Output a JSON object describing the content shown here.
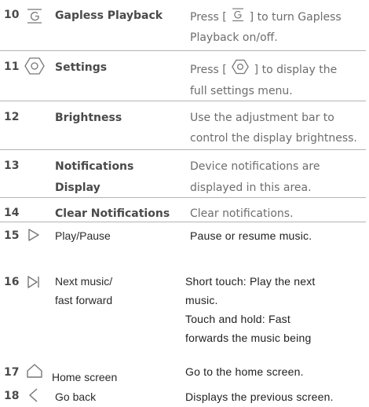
{
  "rows": [
    {
      "num": "10",
      "icon": "gapless-playback-icon",
      "name": "Gapless Playback",
      "desc_pre": "Press [",
      "desc_post": "] to turn Gapless",
      "desc_line2": "Playback on/off."
    },
    {
      "num": "11",
      "icon": "settings-icon",
      "name": "Settings",
      "desc_pre": "Press [",
      "desc_post": "] to display the",
      "desc_line2": "full settings menu."
    },
    {
      "num": "12",
      "name": "Brightness",
      "desc_line1": "Use the adjustment bar to",
      "desc_line2": "control the display brightness."
    },
    {
      "num": "13",
      "name_line1": "Notifications",
      "name_line2": "Display",
      "desc_line1": "Device notifications are",
      "desc_line2": "displayed in this area."
    },
    {
      "num": "14",
      "name": "Clear Notifications",
      "desc_line1": "Clear notifications."
    },
    {
      "num": "15",
      "icon": "play-pause-icon",
      "name": "Play/Pause",
      "desc_line1": "Pause or resume music."
    },
    {
      "num": "16",
      "icon": "next-icon",
      "name_line1": "Next music/",
      "name_line2": "fast forward",
      "desc_line1": "Short touch: Play the next",
      "desc_line2": "music.",
      "desc_line3": "Touch and hold: Fast",
      "desc_line4": "forwards the music being"
    },
    {
      "num": "17",
      "icon": "home-icon",
      "name": "Home screen",
      "desc_line1": "Go to the home screen."
    },
    {
      "num": "18",
      "icon": "back-icon",
      "name": "Go back",
      "desc_line1": "Displays the previous screen."
    }
  ]
}
